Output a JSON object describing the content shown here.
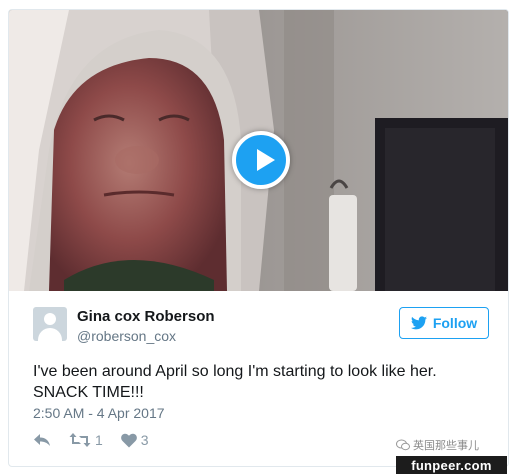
{
  "tweet": {
    "author_name": "Gina cox Roberson",
    "author_handle": "@roberson_cox",
    "follow_label": "Follow",
    "text_lines": [
      "I've been around April so long I'm starting to look like her.",
      "SNACK TIME!!!"
    ],
    "timestamp": "2:50 AM - 4 Apr 2017",
    "retweet_count": "1",
    "like_count": "3"
  },
  "icons": {
    "play": "play-icon",
    "reply": "reply-icon",
    "retweet": "retweet-icon",
    "like": "heart-icon",
    "twitter": "twitter-bird-icon",
    "avatar": "default-avatar-icon",
    "wechat": "wechat-icon"
  },
  "watermark": {
    "wechat_text": "英国那些事儿",
    "site": "funpeer.com"
  },
  "colors": {
    "twitter_blue": "#1da1f2",
    "text": "#14171a",
    "muted": "#657786",
    "border": "#e1e8ed"
  }
}
